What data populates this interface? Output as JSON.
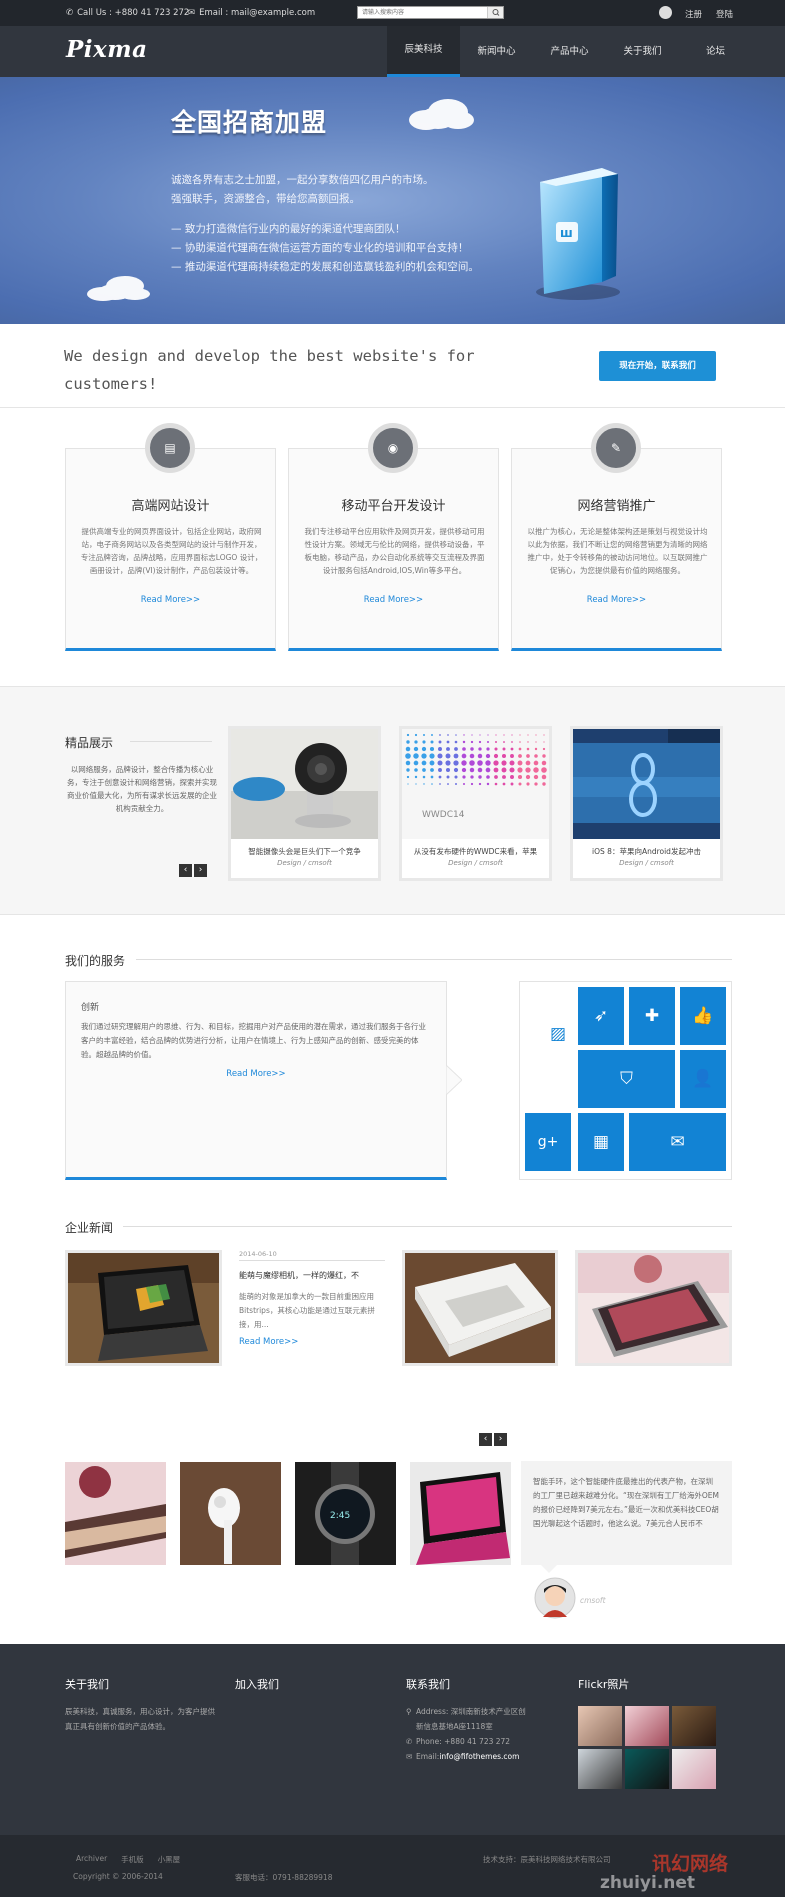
{
  "topbar": {
    "phone": "Call Us : +880 41 723 272",
    "email": "Email : mail@example.com",
    "search_placeholder": "请输入搜索内容",
    "register": "注册",
    "login": "登陆"
  },
  "header": {
    "logo": "Pixma",
    "nav": [
      "辰美科技",
      "新闻中心",
      "产品中心",
      "关于我们",
      "论坛"
    ]
  },
  "banner": {
    "title": "全国招商加盟",
    "line1": "诚邀各界有志之士加盟，一起分享数倍四亿用户的市场。",
    "line2": "强强联手，资源整合，带给您高额回报。",
    "bullet1": "— 致力打造微信行业内的最好的渠道代理商团队！",
    "bullet2": "— 协助渠道代理商在微信运营方面的专业化的培训和平台支持！",
    "bullet3": "— 推动渠道代理商持续稳定的发展和创造赢钱盈利的机会和空间。"
  },
  "tagline": {
    "text": "We design and develop the best website's for customers!",
    "button": "现在开始，联系我们"
  },
  "features": [
    {
      "title": "高端网站设计",
      "text": "提供高端专业的网页界面设计，包括企业网站，政府网站，电子商务网站以及各类型网站的设计与制作开发，专注品牌咨询，品牌战略，应用界面标志LOGO 设计，画册设计，品牌(VI)设计制作，产品包装设计等。",
      "link": "Read More>>"
    },
    {
      "title": "移动平台开发设计",
      "text": "我们专注移动平台应用软件及网页开发，提供移动可用性设计方案。领域无与伦比的网络，提供移动设备，平板电脑，移动产品，办公自动化系统等交互流程及界面设计服务包括Android,IOS,Win等多平台。",
      "link": "Read More>>"
    },
    {
      "title": "网络营销推广",
      "text": "以推广为核心，无论是整体架构还是策划与视觉设计均以此为依据，我们不断让您的网络营销更为清晰的网络推广中，处于令转移角的被动访问地位。以互联网推广促销心，为您提供最有价值的网络服务。",
      "link": "Read More>>"
    }
  ],
  "showcase": {
    "title": "精品展示",
    "text": "以网络服务，品牌设计，整合传播为核心业务，专注于创意设计和网络营销，探索并实现商业价值最大化，为所有谋求长远发展的企业机构贡献全力。",
    "prev": "‹",
    "next": "›",
    "cards": [
      {
        "title": "智能摄像头会是巨头们下一个竞争",
        "sub": "Design / cmsoft"
      },
      {
        "title": "从没有发布硬件的WWDC来看，苹果",
        "sub": "Design / cmsoft",
        "img_text": "WWDC14"
      },
      {
        "title": "iOS 8：苹果向Android发起冲击",
        "sub": "Design / cmsoft"
      }
    ]
  },
  "services": {
    "title": "我们的服务",
    "heading": "创新",
    "text": "我们通过研究理解用户的思维、行为、和目标，挖掘用户对产品使用的潜在需求，通过我们服务于各行业客户的丰富经验，结合品牌的优势进行分析，让用户在情境上、行为上感知产品的创新、感受完美的体验。超越品牌的价值。",
    "link": "Read More>>"
  },
  "news": {
    "title": "企业新闻",
    "date": "2014-06-10",
    "headline": "能萌与魔缪相机，一样的爆红，不",
    "text": "能萌的对象是加拿大的一款目前重困应用Bitstrips，其核心功能是通过互联元素拼接，用...",
    "link": "Read More>>"
  },
  "testimonial": {
    "prev": "‹",
    "next": "›",
    "quote": "智能手环，这个智能硬件底最推出的代表产物，在深圳的工厂里已越来越难分化。“现在深圳有工厂给海外OEM的报价已经降到7美元左右。”最近一次和优美科技CEO胡国光聊起这个话题时，他这么说。7美元合人民币不",
    "author": "cmsoft"
  },
  "footer": {
    "col1_title": "关于我们",
    "col1_text": "辰美科技，真诚服务，用心设计，为客户提供真正具有创新价值的产品体验。",
    "col2_title": "加入我们",
    "col3_title": "联系我们",
    "address": "Address: 深圳南新技术产业区创新信息基地A座1118室",
    "phone": "Phone: +880 41 723 272",
    "email_label": "Email:",
    "email": "info@fifothemes.com",
    "col4_title": "Flickr照片"
  },
  "bottom": {
    "links": [
      "Archiver",
      "手机版",
      "小黑屋"
    ],
    "copyright": "Copyright © 2006-2014",
    "hotline": "客服电话：0791-88289918",
    "support": "技术支持：辰美科技网络技术有限公司",
    "watermark": "讯幻网络",
    "watermark_url": "zhuiyi.net"
  },
  "colors": {
    "accent": "#1e88d9",
    "tile_blue": "#1283d4",
    "dark_bg": "#31363e"
  }
}
